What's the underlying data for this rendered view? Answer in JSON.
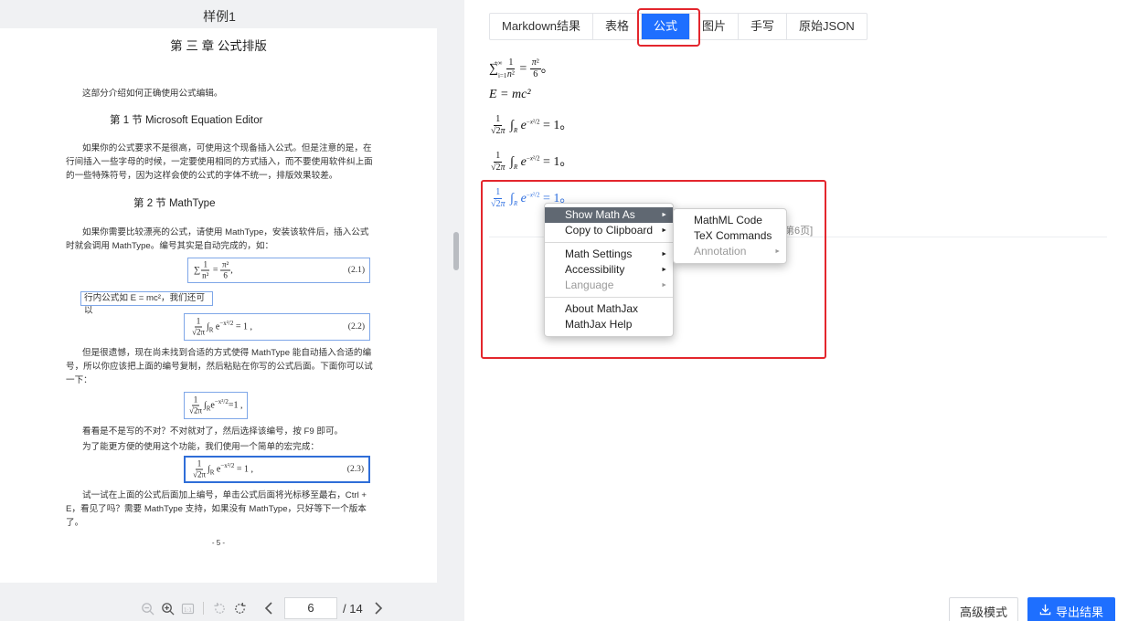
{
  "left": {
    "doc_title": "样例1",
    "page": {
      "chapter_title": "第 三 章   公式排版",
      "intro": "这部分介绍如何正确使用公式编辑。",
      "section1_title": "第 1 节    Microsoft Equation Editor",
      "para1": "如果你的公式要求不是很高，可使用这个现备插入公式。但是注意的是，在行间插入一些字母的时候，一定要使用相同的方式插入，而不要使用软件纠上面的一些特殊符号，因为这样会使的公式的字体不统一，排版效果较差。",
      "section2_title": "第 2 节       MathType",
      "para2": "如果你需要比较漂亮的公式，请使用 MathType，安装该软件后，插入公式时就会调用 MathType。编号其实是自动完成的，如：",
      "eq1_num": "(2.1)",
      "inline_text": "行内公式如 E = mc²，我们还可以",
      "eq2_num": "(2.2)",
      "para3": "但是很遗憾，现在尚未找到合适的方式使得 MathType 能自动插入合适的编号，所以你应该把上面的编号复制，然后粘贴在你写的公式后面。下面你可以试一下：",
      "para4a": "看看是不是写的不对？不对就对了，然后选择该编号，按 F9 即可。",
      "para4b": "为了能更方便的使用这个功能，我们使用一个简单的宏完成：",
      "eq3_num": "(2.3)",
      "para5": "试一试在上面的公式后面加上编号，单击公式后面将光标移至最右，Ctrl + E，看见了吗？需要 MathType 支持，如果没有 MathType，只好等下一个版本了。",
      "page_footer": "- 5 -"
    },
    "pager": {
      "current_page": "6",
      "total": "/ 14"
    }
  },
  "right": {
    "tabs": [
      {
        "label": "Markdown结果"
      },
      {
        "label": "表格"
      },
      {
        "label": "公式"
      },
      {
        "label": "图片"
      },
      {
        "label": "手写"
      },
      {
        "label": "原始JSON"
      }
    ],
    "active_tab": "公式",
    "formulas": {
      "f1_text": "。",
      "f2_text": "E = mc²",
      "f3_end": "= 1。",
      "f4_end": "= 1。",
      "f5_end": "= 1。"
    },
    "page_ref": "第6页]",
    "menu": {
      "items": [
        "Show Math As",
        "Copy to Clipboard",
        "Math Settings",
        "Accessibility",
        "Language",
        "About MathJax",
        "MathJax Help"
      ],
      "submenu": [
        "MathML Code",
        "TeX Commands",
        "Annotation"
      ]
    },
    "buttons": {
      "advanced": "高级模式",
      "export": "导出结果"
    }
  },
  "colors": {
    "accent": "#1e6fff",
    "highlight_red": "#e3262d",
    "menu_highlight": "#606872"
  }
}
